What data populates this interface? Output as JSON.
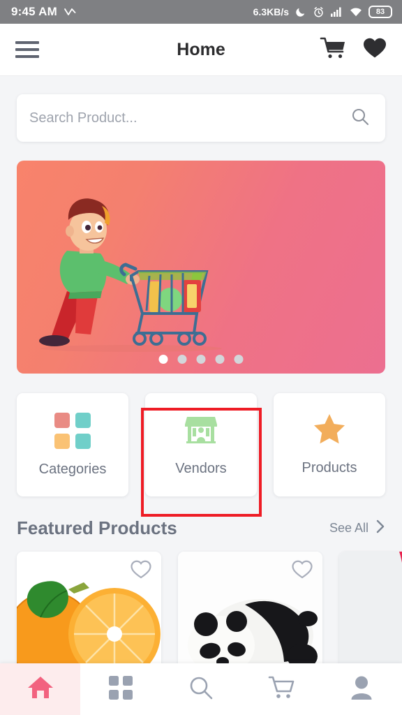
{
  "status_bar": {
    "time": "9:45 AM",
    "network_speed": "6.3KB/s",
    "battery_level": "83",
    "icons": [
      "collapse-chevron-icon",
      "do-not-disturb-moon-icon",
      "alarm-clock-icon",
      "signal-bars-icon",
      "wifi-icon",
      "battery-icon"
    ]
  },
  "app_bar": {
    "title": "Home",
    "menu_icon": "hamburger-menu-icon",
    "cart_icon": "shopping-cart-icon",
    "wishlist_icon": "heart-filled-icon"
  },
  "search": {
    "placeholder": "Search Product...",
    "value": "",
    "icon": "search-icon"
  },
  "banner": {
    "illustration": "man-pushing-shopping-cart-illustration",
    "gradient_start": "#f8836b",
    "gradient_end": "#ec6f90",
    "dots_total": 5,
    "dots_active_index": 0
  },
  "shortcuts": [
    {
      "label": "Categories",
      "icon": "grid-squares-icon",
      "colors": [
        "#e98b84",
        "#70cfc9",
        "#fac274",
        "#70cfc9"
      ],
      "highlighted": false
    },
    {
      "label": "Vendors",
      "icon": "storefront-icon",
      "colors": [
        "#a8dfa0"
      ],
      "highlighted": true
    },
    {
      "label": "Products",
      "icon": "star-filled-icon",
      "colors": [
        "#f2ad5b"
      ],
      "highlighted": false
    }
  ],
  "featured": {
    "title": "Featured Products",
    "see_all_label": "See All",
    "see_all_icon": "chevron-right-icon",
    "products": [
      {
        "image": "orange-citrus-fruit-photo",
        "favorite_icon": "heart-outline-icon",
        "favorited": false
      },
      {
        "image": "panda-plush-toy-photo",
        "favorite_icon": "heart-outline-icon",
        "favorited": false
      },
      {
        "image": "pink-dress-photo",
        "favorite_icon": "heart-outline-icon",
        "favorited": false
      }
    ]
  },
  "bottom_nav": {
    "active_index": 0,
    "active_color": "#f2627f",
    "inactive_color": "#9aa2b1",
    "items": [
      {
        "name": "home",
        "icon": "home-icon"
      },
      {
        "name": "categories",
        "icon": "grid-icon"
      },
      {
        "name": "search",
        "icon": "search-icon"
      },
      {
        "name": "cart",
        "icon": "shopping-cart-icon"
      },
      {
        "name": "account",
        "icon": "person-icon"
      }
    ]
  },
  "annotation": {
    "target": "Vendors",
    "color": "#ee1c25"
  }
}
